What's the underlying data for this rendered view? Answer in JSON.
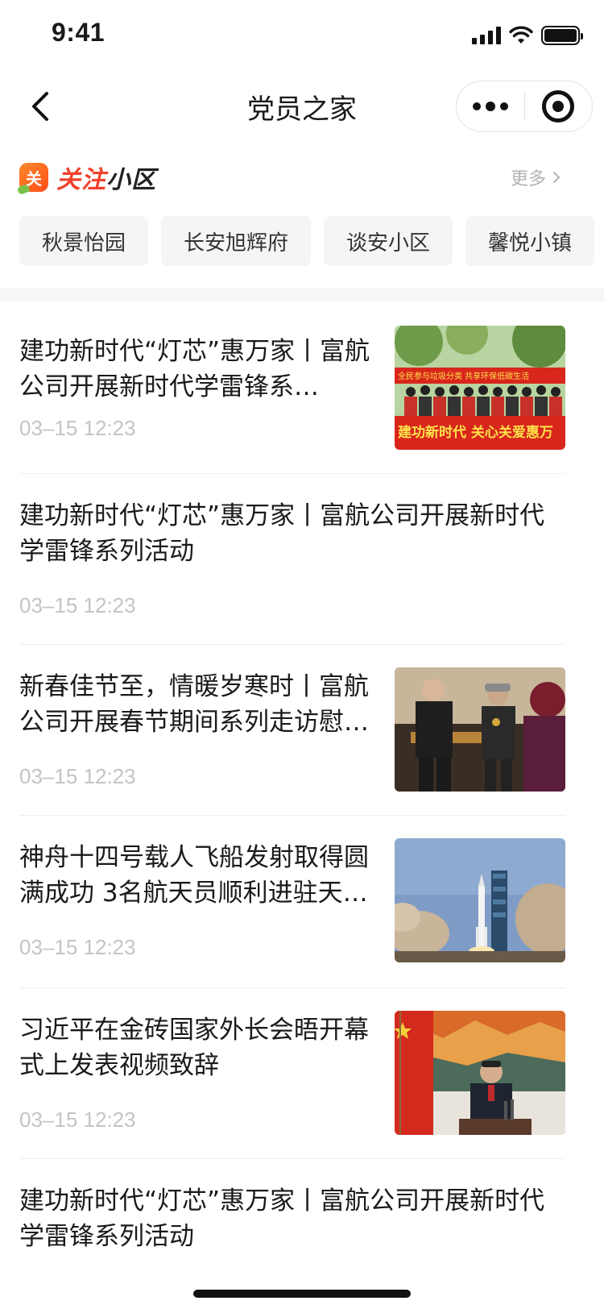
{
  "status_bar": {
    "time": "9:41"
  },
  "nav": {
    "title": "党员之家"
  },
  "follow": {
    "logo_char": "关",
    "title_red": "关注",
    "title_dark": "小区",
    "more_label": "更多",
    "communities": [
      "秋景怡园",
      "长安旭辉府",
      "谈安小区",
      "馨悦小镇"
    ]
  },
  "news": [
    {
      "title": "建功新时代“灯芯”惠万家丨富航公司开展新时代学雷锋系…",
      "time": "03–15 12:23",
      "thumb_text_1": "建功新时代  关心关爱惠万",
      "thumb_text_2": "全民参与垃圾分类 共享环保低碳生活"
    },
    {
      "title": "建功新时代“灯芯”惠万家丨富航公司开展新时代学雷锋系列活动",
      "time": "03–15 12:23"
    },
    {
      "title": "新春佳节至，情暖岁寒时丨富航公司开展春节期间系列走访慰…",
      "time": "03–15 12:23"
    },
    {
      "title": "神舟十四号载人飞船发射取得圆满成功 3名航天员顺利进驻天…",
      "time": "03–15 12:23"
    },
    {
      "title": "习近平在金砖国家外长会晤开幕式上发表视频致辞",
      "time": "03–15 12:23"
    },
    {
      "title": "建功新时代“灯芯”惠万家丨富航公司开展新时代学雷锋系列活动",
      "time": ""
    }
  ]
}
